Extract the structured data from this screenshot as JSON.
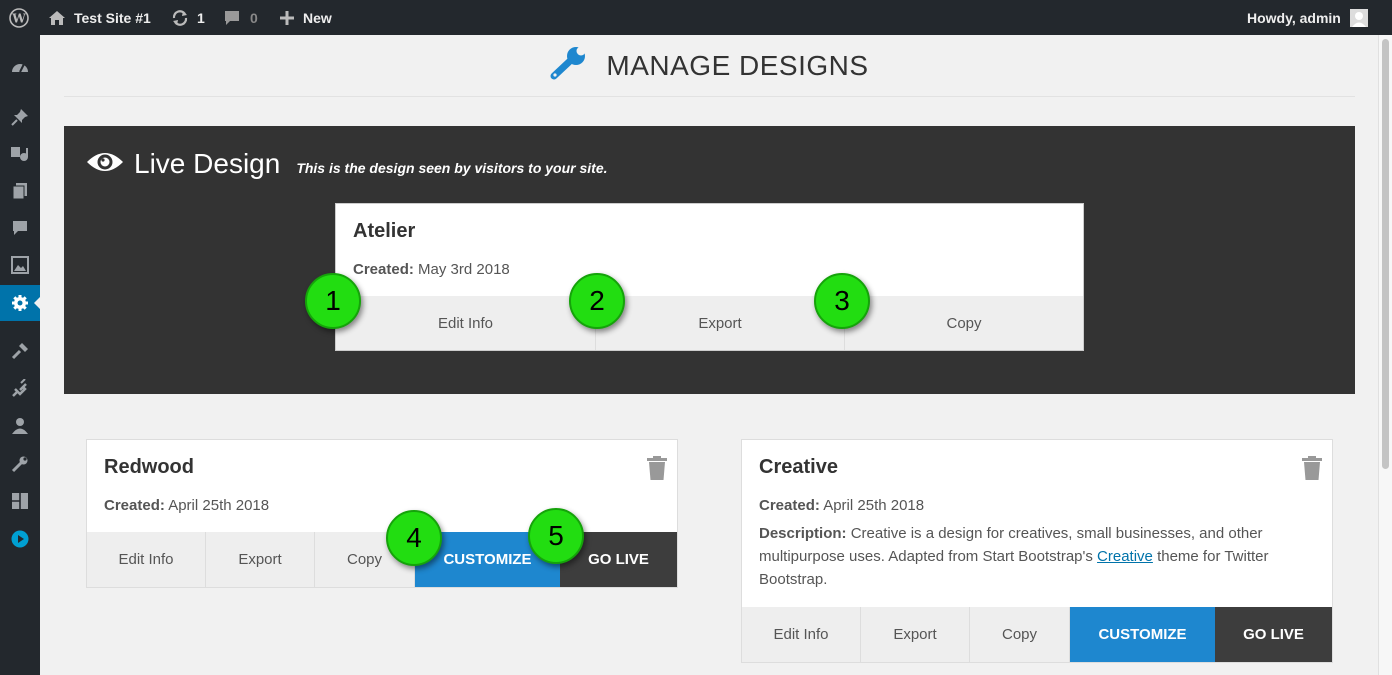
{
  "adminbar": {
    "site_name": "Test Site #1",
    "updates_count": "1",
    "comments_count": "0",
    "new_label": "New",
    "greeting": "Howdy, admin"
  },
  "sidebar": {
    "icons": [
      "dashboard-icon",
      "pin-icon",
      "media-icon",
      "pages-icon",
      "comments-icon",
      "gallery-icon",
      "settings-icon",
      "appearance-icon",
      "plugins-icon",
      "users-icon",
      "tools-icon",
      "layout-icon",
      "play-icon"
    ],
    "active": "settings-icon"
  },
  "page": {
    "title": "MANAGE DESIGNS",
    "title_icon": "wrench-icon"
  },
  "live": {
    "heading": "Live Design",
    "description": "This is the design seen by visitors to your site.",
    "card": {
      "name": "Atelier",
      "created_label": "Created:",
      "created_date": "May 3rd 2018",
      "buttons": [
        "Edit Info",
        "Export",
        "Copy"
      ]
    }
  },
  "designs": [
    {
      "name": "Redwood",
      "created_label": "Created:",
      "created_date": "April 25th 2018",
      "buttons": [
        "Edit Info",
        "Export",
        "Copy",
        "CUSTOMIZE",
        "GO LIVE"
      ]
    },
    {
      "name": "Creative",
      "created_label": "Created:",
      "created_date": "April 25th 2018",
      "description_label": "Description:",
      "description_text": "Creative is a design for creatives, small businesses, and other multipurpose uses. Adapted from Start Bootstrap's",
      "description_link": "Creative",
      "description_tail": "theme for Twitter Bootstrap.",
      "buttons": [
        "Edit Info",
        "Export",
        "Copy",
        "CUSTOMIZE",
        "GO LIVE"
      ]
    }
  ],
  "markers": [
    "1",
    "2",
    "3",
    "4",
    "5"
  ],
  "colors": {
    "admin_dark": "#23282d",
    "accent_blue": "#0073aa",
    "customize_blue": "#1e87cf",
    "golive_dark": "#3d3d3d",
    "live_panel": "#333333",
    "marker_green": "#22dd11"
  }
}
